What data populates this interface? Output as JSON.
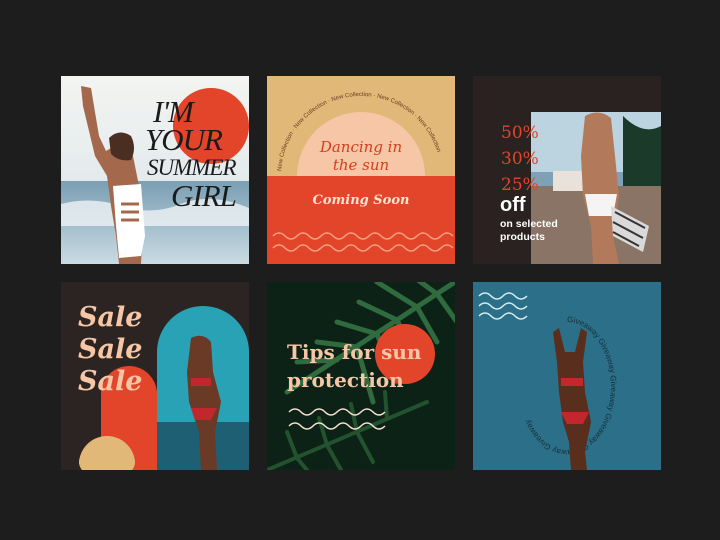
{
  "tile1": {
    "line1": "I'M",
    "line2": "YOUR",
    "line3": "SUMMER",
    "line4": "GIRL"
  },
  "tile2": {
    "arc_text": "New Collection · New Collection · New Collection · New Collection · New Collection",
    "headline": "Dancing in the sun",
    "cta": "Coming Soon"
  },
  "tile3": {
    "pct1": "50%",
    "pct2": "30%",
    "pct3": "25%",
    "off": "off",
    "sub1": "on selected",
    "sub2": "products"
  },
  "tile4": {
    "line1": "Sale",
    "line2": "Sale",
    "line3": "Sale"
  },
  "tile5": {
    "line1": "Tips for sun",
    "line2": "protection"
  },
  "tile6": {
    "ring_text": "Giveaway Giveaway Giveaway Giveaway Giveaway Giveaway"
  },
  "colors": {
    "page_bg": "#1d1d1d",
    "orange": "#e2452a",
    "sand": "#e1b877",
    "peach": "#f6c6a6",
    "teal": "#2b6f88",
    "dark_brown": "#2b2422",
    "cream": "#f7e3d2"
  }
}
